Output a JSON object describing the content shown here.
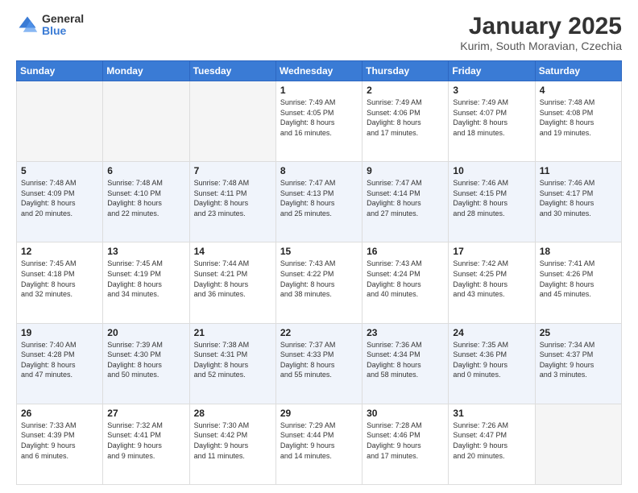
{
  "logo": {
    "general": "General",
    "blue": "Blue"
  },
  "title": "January 2025",
  "subtitle": "Kurim, South Moravian, Czechia",
  "headers": [
    "Sunday",
    "Monday",
    "Tuesday",
    "Wednesday",
    "Thursday",
    "Friday",
    "Saturday"
  ],
  "weeks": [
    [
      {
        "day": "",
        "info": ""
      },
      {
        "day": "",
        "info": ""
      },
      {
        "day": "",
        "info": ""
      },
      {
        "day": "1",
        "info": "Sunrise: 7:49 AM\nSunset: 4:05 PM\nDaylight: 8 hours\nand 16 minutes."
      },
      {
        "day": "2",
        "info": "Sunrise: 7:49 AM\nSunset: 4:06 PM\nDaylight: 8 hours\nand 17 minutes."
      },
      {
        "day": "3",
        "info": "Sunrise: 7:49 AM\nSunset: 4:07 PM\nDaylight: 8 hours\nand 18 minutes."
      },
      {
        "day": "4",
        "info": "Sunrise: 7:48 AM\nSunset: 4:08 PM\nDaylight: 8 hours\nand 19 minutes."
      }
    ],
    [
      {
        "day": "5",
        "info": "Sunrise: 7:48 AM\nSunset: 4:09 PM\nDaylight: 8 hours\nand 20 minutes."
      },
      {
        "day": "6",
        "info": "Sunrise: 7:48 AM\nSunset: 4:10 PM\nDaylight: 8 hours\nand 22 minutes."
      },
      {
        "day": "7",
        "info": "Sunrise: 7:48 AM\nSunset: 4:11 PM\nDaylight: 8 hours\nand 23 minutes."
      },
      {
        "day": "8",
        "info": "Sunrise: 7:47 AM\nSunset: 4:13 PM\nDaylight: 8 hours\nand 25 minutes."
      },
      {
        "day": "9",
        "info": "Sunrise: 7:47 AM\nSunset: 4:14 PM\nDaylight: 8 hours\nand 27 minutes."
      },
      {
        "day": "10",
        "info": "Sunrise: 7:46 AM\nSunset: 4:15 PM\nDaylight: 8 hours\nand 28 minutes."
      },
      {
        "day": "11",
        "info": "Sunrise: 7:46 AM\nSunset: 4:17 PM\nDaylight: 8 hours\nand 30 minutes."
      }
    ],
    [
      {
        "day": "12",
        "info": "Sunrise: 7:45 AM\nSunset: 4:18 PM\nDaylight: 8 hours\nand 32 minutes."
      },
      {
        "day": "13",
        "info": "Sunrise: 7:45 AM\nSunset: 4:19 PM\nDaylight: 8 hours\nand 34 minutes."
      },
      {
        "day": "14",
        "info": "Sunrise: 7:44 AM\nSunset: 4:21 PM\nDaylight: 8 hours\nand 36 minutes."
      },
      {
        "day": "15",
        "info": "Sunrise: 7:43 AM\nSunset: 4:22 PM\nDaylight: 8 hours\nand 38 minutes."
      },
      {
        "day": "16",
        "info": "Sunrise: 7:43 AM\nSunset: 4:24 PM\nDaylight: 8 hours\nand 40 minutes."
      },
      {
        "day": "17",
        "info": "Sunrise: 7:42 AM\nSunset: 4:25 PM\nDaylight: 8 hours\nand 43 minutes."
      },
      {
        "day": "18",
        "info": "Sunrise: 7:41 AM\nSunset: 4:26 PM\nDaylight: 8 hours\nand 45 minutes."
      }
    ],
    [
      {
        "day": "19",
        "info": "Sunrise: 7:40 AM\nSunset: 4:28 PM\nDaylight: 8 hours\nand 47 minutes."
      },
      {
        "day": "20",
        "info": "Sunrise: 7:39 AM\nSunset: 4:30 PM\nDaylight: 8 hours\nand 50 minutes."
      },
      {
        "day": "21",
        "info": "Sunrise: 7:38 AM\nSunset: 4:31 PM\nDaylight: 8 hours\nand 52 minutes."
      },
      {
        "day": "22",
        "info": "Sunrise: 7:37 AM\nSunset: 4:33 PM\nDaylight: 8 hours\nand 55 minutes."
      },
      {
        "day": "23",
        "info": "Sunrise: 7:36 AM\nSunset: 4:34 PM\nDaylight: 8 hours\nand 58 minutes."
      },
      {
        "day": "24",
        "info": "Sunrise: 7:35 AM\nSunset: 4:36 PM\nDaylight: 9 hours\nand 0 minutes."
      },
      {
        "day": "25",
        "info": "Sunrise: 7:34 AM\nSunset: 4:37 PM\nDaylight: 9 hours\nand 3 minutes."
      }
    ],
    [
      {
        "day": "26",
        "info": "Sunrise: 7:33 AM\nSunset: 4:39 PM\nDaylight: 9 hours\nand 6 minutes."
      },
      {
        "day": "27",
        "info": "Sunrise: 7:32 AM\nSunset: 4:41 PM\nDaylight: 9 hours\nand 9 minutes."
      },
      {
        "day": "28",
        "info": "Sunrise: 7:30 AM\nSunset: 4:42 PM\nDaylight: 9 hours\nand 11 minutes."
      },
      {
        "day": "29",
        "info": "Sunrise: 7:29 AM\nSunset: 4:44 PM\nDaylight: 9 hours\nand 14 minutes."
      },
      {
        "day": "30",
        "info": "Sunrise: 7:28 AM\nSunset: 4:46 PM\nDaylight: 9 hours\nand 17 minutes."
      },
      {
        "day": "31",
        "info": "Sunrise: 7:26 AM\nSunset: 4:47 PM\nDaylight: 9 hours\nand 20 minutes."
      },
      {
        "day": "",
        "info": ""
      }
    ]
  ]
}
